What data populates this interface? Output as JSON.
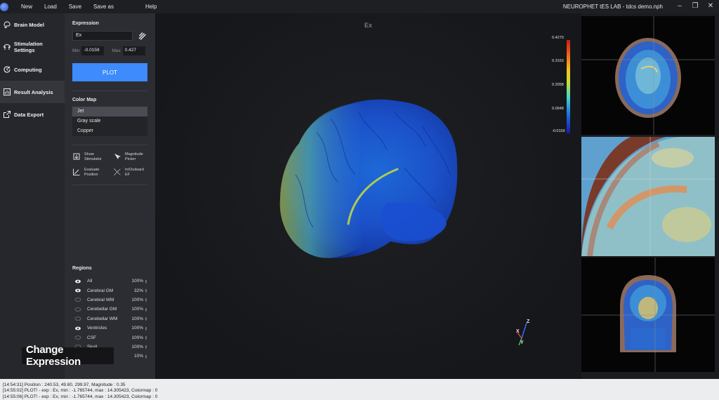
{
  "menu": [
    "New",
    "Load",
    "Save",
    "Save as",
    "Help"
  ],
  "window_title": "NEUROPHET tES LAB - tdcs demo.nph",
  "nav": [
    {
      "label": "Brain Model",
      "icon": "brain-icon"
    },
    {
      "label": "Stimulation Settings",
      "icon": "stimulation-icon"
    },
    {
      "label": "Computing",
      "icon": "computing-icon"
    },
    {
      "label": "Result Analysis",
      "icon": "result-analysis-icon",
      "active": true
    },
    {
      "label": "Data Export",
      "icon": "export-icon"
    }
  ],
  "expression": {
    "title": "Expression",
    "value": "Ex",
    "min_label": "Min",
    "min_value": "-0.0159",
    "max_label": "Max",
    "max_value": "0.427",
    "plot_label": "PLOT"
  },
  "colormap": {
    "title": "Color Map",
    "items": [
      "Jet",
      "Gray scale",
      "Copper"
    ],
    "selected": "Jet"
  },
  "tools": [
    {
      "label": "Show Stimulator",
      "icon": "show-stimulator-icon"
    },
    {
      "label": "Magnitude Picker",
      "icon": "magnitude-picker-icon"
    },
    {
      "label": "Evaluate Position",
      "icon": "evaluate-position-icon"
    },
    {
      "label": "In/Outward EF",
      "icon": "inoutward-ef-icon"
    }
  ],
  "regions": {
    "title": "Regions",
    "items": [
      {
        "name": "All",
        "pct": "100%",
        "visible": true
      },
      {
        "name": "Cerebral GM",
        "pct": "32%",
        "visible": true
      },
      {
        "name": "Cerebral WM",
        "pct": "100%",
        "visible": false
      },
      {
        "name": "Cerebellar GM",
        "pct": "100%",
        "visible": false
      },
      {
        "name": "Cerebellar WM",
        "pct": "100%",
        "visible": false
      },
      {
        "name": "Ventricles",
        "pct": "100%",
        "visible": true
      },
      {
        "name": "CSF",
        "pct": "100%",
        "visible": false
      },
      {
        "name": "Skull",
        "pct": "100%",
        "visible": false
      },
      {
        "name": "",
        "pct": "10%",
        "visible": false
      }
    ]
  },
  "viewport": {
    "label": "Ex",
    "colorbar_ticks": [
      "0.4270",
      "0.3163",
      "0.2058",
      "0.0948",
      "-0.0159"
    ],
    "axis_labels": [
      "Z",
      "X",
      "Y"
    ]
  },
  "console": [
    "[14:54:31] Position : 240.53, 49.80, 299.97, Magnitude : 0.35",
    "[14:55:02] PLOT! - exp : Ex, min : -1.765744, max : 14.305423, Colormap : 0",
    "[14:55:06] PLOT! - exp : Ex, min : -1.765744, max : 14.305423, Colormap : 0"
  ],
  "caption": "Change Expression"
}
